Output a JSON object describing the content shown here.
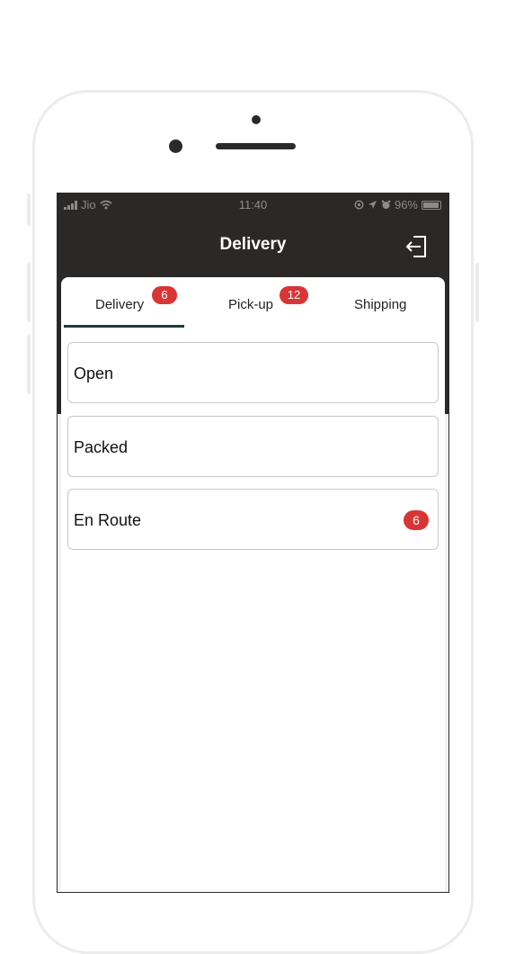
{
  "status_bar": {
    "carrier": "Jio",
    "time": "11:40",
    "battery": "96%",
    "battery_level": 0.96
  },
  "header": {
    "title": "Delivery",
    "logout_icon": "logout-icon"
  },
  "tabs": [
    {
      "label": "Delivery",
      "badge": "6",
      "active": true
    },
    {
      "label": "Pick-up",
      "badge": "12",
      "active": false
    },
    {
      "label": "Shipping",
      "badge": "",
      "active": false
    }
  ],
  "status_list": [
    {
      "label": "Open",
      "badge": ""
    },
    {
      "label": "Packed",
      "badge": ""
    },
    {
      "label": "En Route",
      "badge": "6"
    }
  ],
  "colors": {
    "header_bg": "#2b2828",
    "badge": "#d93535",
    "tab_underline": "#1f3a3a"
  }
}
